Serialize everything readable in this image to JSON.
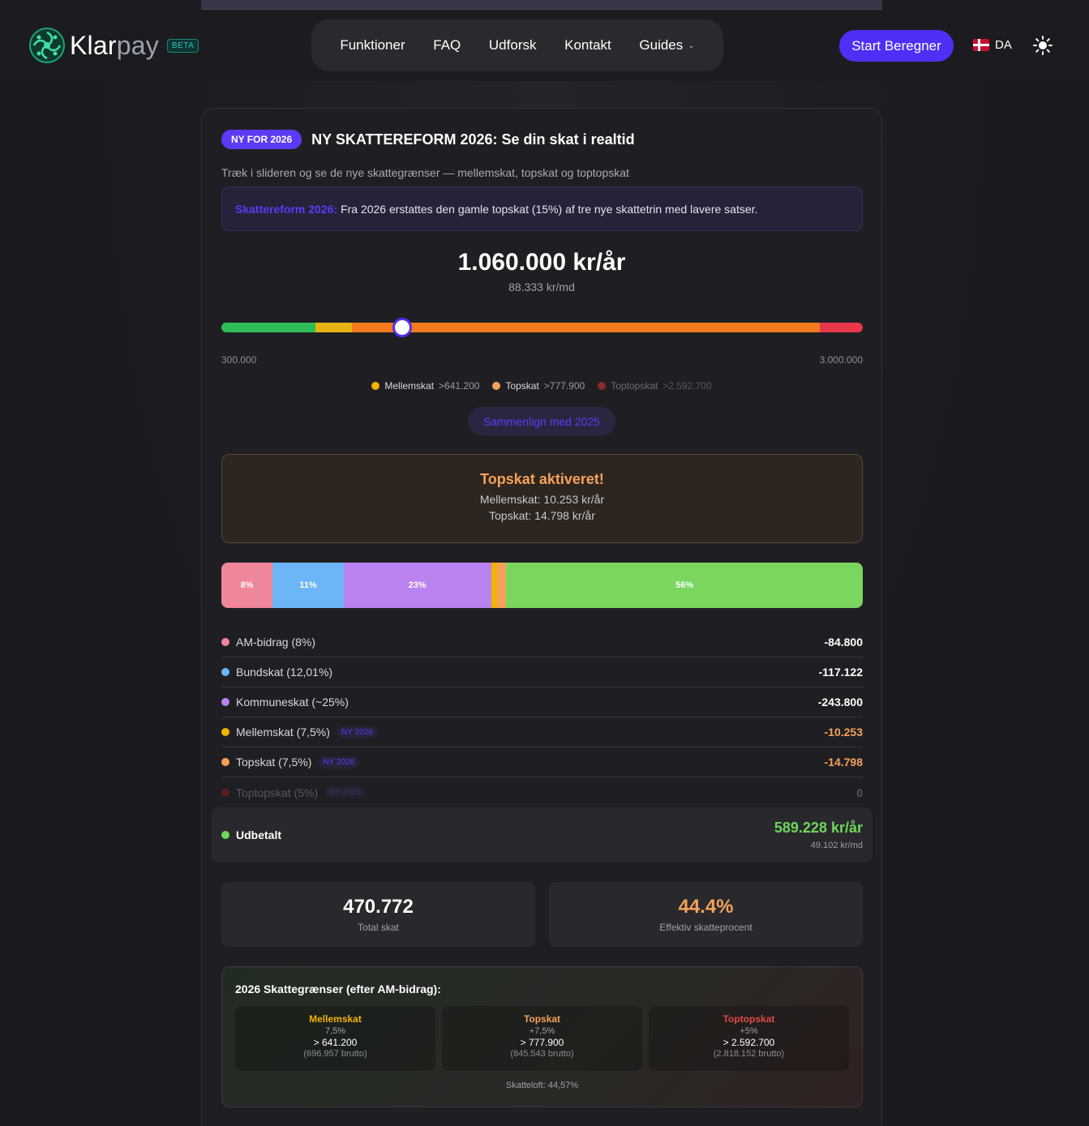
{
  "app": {
    "name_main": "Klar",
    "name_sub": "pay",
    "beta": "BETA"
  },
  "nav": {
    "items": [
      "Funktioner",
      "FAQ",
      "Udforsk",
      "Kontakt",
      "Guides"
    ],
    "cta": "Start Beregner",
    "language": "DA"
  },
  "calculator": {
    "badge": "NY FOR 2026",
    "title": "NY SKATTEREFORM 2026: Se din skat i realtid",
    "subtitle": "Træk i slideren og se de nye skattegrænser — mellemskat, topskat og toptopskat",
    "info_highlight": "Skattereform 2026:",
    "info_text": "Fra 2026 erstattes den gamle topskat (15%) af tre nye skattetrin med lavere satser.",
    "amount": "1.060.000 kr/år",
    "amount_monthly": "88.333 kr/md",
    "slider": {
      "min": 300000,
      "max": 3000000,
      "value": 1060000,
      "min_label": "300.000",
      "max_label": "3.000.000"
    },
    "legend": [
      {
        "name": "Mellemskat",
        "threshold": ">641.200",
        "color": "#f0b400"
      },
      {
        "name": "Topskat",
        "threshold": ">777.900",
        "color": "#f5a15a"
      },
      {
        "name": "Toptopskat",
        "threshold": ">2.592.700",
        "color": "#8a2a2a"
      }
    ],
    "compare_button": "Sammenlign med 2025",
    "alert": {
      "title": "Topskat aktiveret!",
      "line1": "Mellemskat: 10.253 kr/år",
      "line2": "Topskat: 14.798 kr/år"
    },
    "breakdown_bar": [
      {
        "label": "8%",
        "share": 8.0,
        "color": "#f0869a"
      },
      {
        "label": "11%",
        "share": 11.05,
        "color": "#6cb6f7"
      },
      {
        "label": "23%",
        "share": 23.0,
        "color": "#b982ee"
      },
      {
        "label": "",
        "share": 0.97,
        "color": "#f0b400"
      },
      {
        "label": "",
        "share": 1.4,
        "color": "#f5a15a"
      },
      {
        "label": "56%",
        "share": 55.6,
        "color": "#7bd65f"
      }
    ],
    "rows": [
      {
        "label": "AM-bidrag (8%)",
        "value": "-84.800",
        "color": "#f0869a"
      },
      {
        "label": "Bundskat (12,01%)",
        "value": "-117.122",
        "color": "#6cb6f7"
      },
      {
        "label": "Kommuneskat (~25%)",
        "value": "-243.800",
        "color": "#b982ee"
      },
      {
        "label": "Mellemskat (7,5%)",
        "tag": "NY 2026",
        "value": "-10.253",
        "color": "#f0b400"
      },
      {
        "label": "Topskat (7,5%)",
        "tag": "NY 2026",
        "value": "-14.798",
        "color": "#f5a15a"
      },
      {
        "label": "Toptopskat (5%)",
        "tag": "NY 2026",
        "value": "0",
        "color": "#5a1e1e"
      }
    ],
    "payout": {
      "label": "Udbetalt",
      "amount": "589.228 kr/år",
      "monthly": "49.102 kr/md"
    },
    "stats": {
      "total_tax": "470.772",
      "total_tax_label": "Total skat",
      "effective_rate": "44.4%",
      "effective_rate_label": "Effektiv skatteprocent"
    },
    "limits": {
      "title": "2026 Skattegrænser (efter AM-bidrag):",
      "items": [
        {
          "name": "Mellemskat",
          "rate": "7,5%",
          "threshold": "> 641.200",
          "gross": "(696.957 brutto)",
          "color": "#f0b400"
        },
        {
          "name": "Topskat",
          "rate": "+7,5%",
          "threshold": "> 777.900",
          "gross": "(845.543 brutto)",
          "color": "#f5a15a"
        },
        {
          "name": "Toptopskat",
          "rate": "+5%",
          "threshold": "> 2.592.700",
          "gross": "(2.818.152 brutto)",
          "color": "#e04848"
        }
      ],
      "cap": "Skatteloft: 44,57%"
    }
  }
}
